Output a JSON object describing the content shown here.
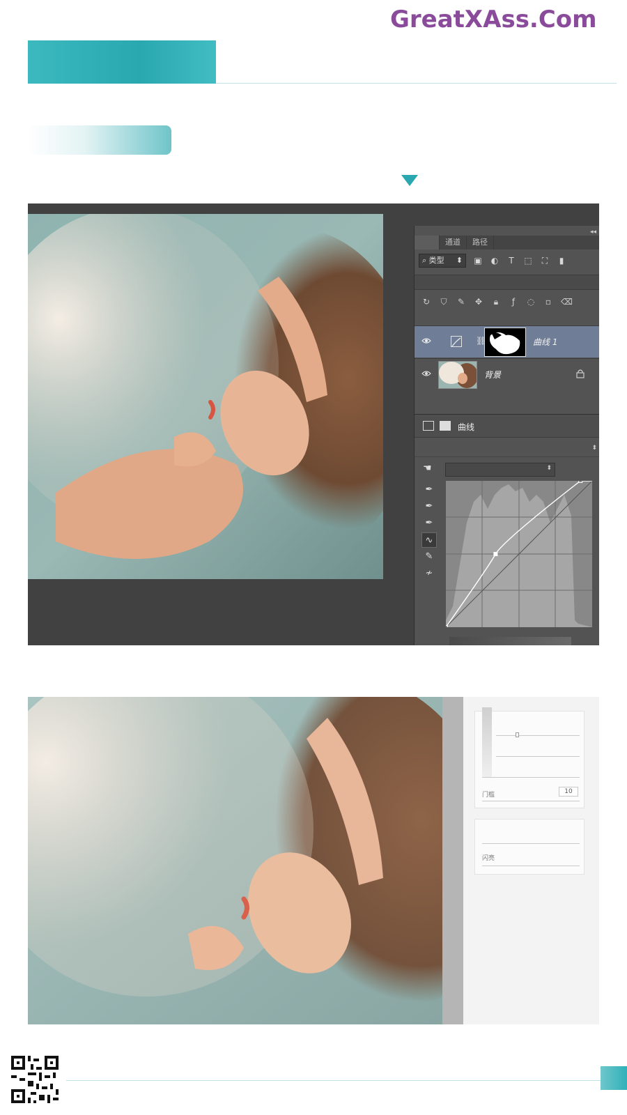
{
  "watermark": "GreatXAss.Com",
  "panel": {
    "collapse_glyph": "◂◂",
    "tabs": [
      "",
      "通道",
      "路径"
    ],
    "filter": {
      "label": "⌕ 类型",
      "caret": "⬍"
    },
    "filter_icons": [
      "image-filter-icon",
      "adjustment-filter-icon",
      "type-filter-icon",
      "shape-filter-icon",
      "smart-object-filter-icon",
      "filter-toggle-icon"
    ],
    "lock_icons": [
      "lock-transparent-icon",
      "lock-pixels-icon",
      "lock-brush-icon",
      "lock-position-icon",
      "lock-all-icon"
    ],
    "layers": [
      {
        "name": "曲线 1",
        "selected": true
      },
      {
        "name": "背景",
        "selected": false
      }
    ],
    "properties_title": "曲线",
    "curve_tools": [
      "on-image-adjust-icon",
      "black-eyedropper-icon",
      "gray-eyedropper-icon",
      "white-eyedropper-icon",
      "curve-point-icon",
      "curve-pencil-icon",
      "smooth-curve-icon"
    ],
    "curve_points": [
      {
        "in": 0,
        "out": 0
      },
      {
        "in": 0.34,
        "out": 0.5
      },
      {
        "in": 0.92,
        "out": 1.0
      }
    ]
  },
  "light_panel": {
    "amount_label": "门槛",
    "amount_value": "10",
    "radius_label": "闪亮"
  },
  "colors": {
    "accent": "#2aa7b0",
    "watermark": "#8a4c9a",
    "selected_layer": "#6f7e96",
    "panel_bg": "#535353"
  }
}
